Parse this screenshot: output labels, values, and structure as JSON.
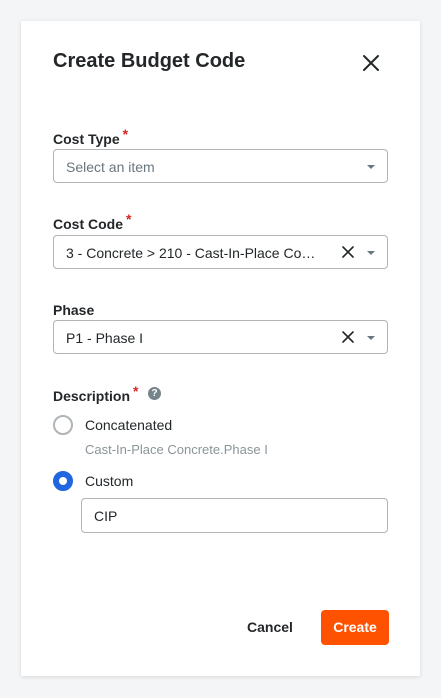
{
  "dialog": {
    "title": "Create Budget Code",
    "close_icon": "close-icon"
  },
  "fields": {
    "cost_type": {
      "label": "Cost Type",
      "required_mark": "*",
      "placeholder": "Select an item"
    },
    "cost_code": {
      "label": "Cost Code",
      "required_mark": "*",
      "value": "3 - Concrete > 210 - Cast-In-Place Conc..."
    },
    "phase": {
      "label": "Phase",
      "value": "P1 - Phase I"
    },
    "description": {
      "label": "Description",
      "required_mark": "*",
      "help_icon": "?",
      "options": [
        {
          "label": "Concatenated",
          "selected": false,
          "helper": "Cast-In-Place Concrete.Phase I"
        },
        {
          "label": "Custom",
          "selected": true
        }
      ],
      "custom_value": "CIP"
    }
  },
  "footer": {
    "cancel_label": "Cancel",
    "create_label": "Create"
  },
  "colors": {
    "accent": "#ff5200",
    "radio_selected": "#2066df",
    "required": "#d92626"
  }
}
